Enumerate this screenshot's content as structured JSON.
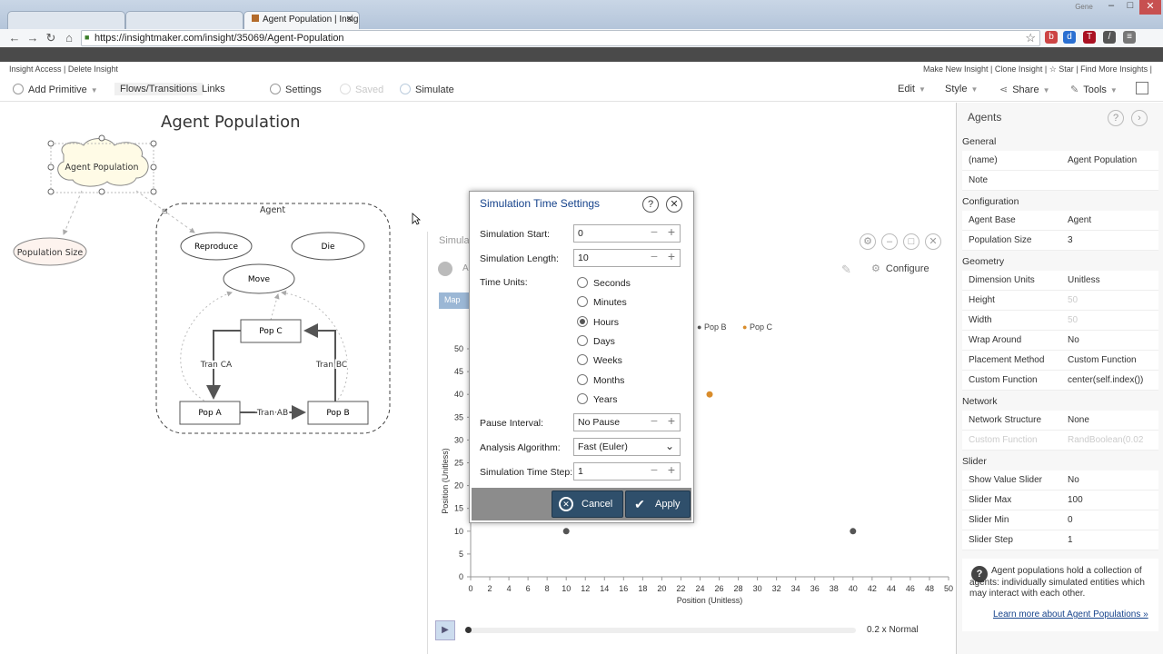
{
  "browser": {
    "tabs": [
      {
        "label": ""
      },
      {
        "label": ""
      },
      {
        "label": "Agent Population | Insight"
      }
    ],
    "window_controls": [
      "Gene",
      "–",
      "□",
      "✕"
    ],
    "url": "https://insightmaker.com/insight/35069/Agent-Population",
    "extensions": [
      "b",
      "d",
      "T",
      "/",
      "≡"
    ],
    "bookmarks": [
      "",
      "",
      "",
      "",
      ""
    ]
  },
  "app": {
    "links_left": "Insight Access | Delete Insight",
    "links_right": "Make New Insight | Clone Insight | ☆ Star | Find More Insights |"
  },
  "toolbar": {
    "add_primitive": "Add Primitive",
    "flows": "Flows/Transitions",
    "links": "Links",
    "settings": "Settings",
    "saved": "Saved",
    "simulate": "Simulate",
    "edit": "Edit",
    "style": "Style",
    "share": "Share",
    "tools": "Tools"
  },
  "diagram": {
    "title": "Agent Population",
    "nodes": {
      "agent_population": "Agent Population",
      "population_size": "Population Size",
      "agent": "Agent",
      "reproduce": "Reproduce",
      "die": "Die",
      "move": "Move",
      "pop_c": "Pop C",
      "pop_a": "Pop A",
      "pop_b": "Pop B",
      "tran_ca": "Tran CA",
      "tran_bc": "Tran BC",
      "tran_ab": "Tran AB"
    }
  },
  "simulation": {
    "title": "Simula",
    "configure": "Configure",
    "map_tab": "Map",
    "legend": [
      "Pop B",
      "Pop C"
    ],
    "play_speed": "0.2 x Normal",
    "chart_data": {
      "type": "scatter",
      "xlabel": "Position (Unitless)",
      "ylabel": "Position (Unitless)",
      "xlim": [
        0,
        50
      ],
      "ylim": [
        0,
        50
      ],
      "x_ticks": [
        0,
        2,
        4,
        6,
        8,
        10,
        12,
        14,
        16,
        18,
        20,
        22,
        24,
        26,
        28,
        30,
        32,
        34,
        36,
        38,
        40,
        42,
        44,
        46,
        48,
        50
      ],
      "y_ticks": [
        0,
        5,
        10,
        15,
        20,
        25,
        30,
        35,
        40,
        45,
        50
      ],
      "series": [
        {
          "name": "Pop A",
          "color": "#555555",
          "points": [
            [
              10,
              10
            ],
            [
              40,
              10
            ]
          ]
        },
        {
          "name": "Pop C",
          "color": "#d98c2b",
          "points": [
            [
              25,
              40
            ]
          ]
        }
      ]
    }
  },
  "dialog": {
    "title": "Simulation Time Settings",
    "sim_start_label": "Simulation Start:",
    "sim_start_value": "0",
    "sim_length_label": "Simulation Length:",
    "sim_length_value": "10",
    "time_units_label": "Time Units:",
    "time_units": [
      {
        "label": "Seconds",
        "selected": false
      },
      {
        "label": "Minutes",
        "selected": false
      },
      {
        "label": "Hours",
        "selected": true
      },
      {
        "label": "Days",
        "selected": false
      },
      {
        "label": "Weeks",
        "selected": false
      },
      {
        "label": "Months",
        "selected": false
      },
      {
        "label": "Years",
        "selected": false
      }
    ],
    "pause_interval_label": "Pause Interval:",
    "pause_interval_value": "No Pause",
    "algorithm_label": "Analysis Algorithm:",
    "algorithm_value": "Fast (Euler)",
    "time_step_label": "Simulation Time Step:",
    "time_step_value": "1",
    "cancel": "Cancel",
    "apply": "Apply"
  },
  "props": {
    "header": "Agents",
    "sections": {
      "general": "General",
      "configuration": "Configuration",
      "geometry": "Geometry",
      "network": "Network",
      "slider": "Slider"
    },
    "rows": {
      "name": {
        "k": "(name)",
        "v": "Agent Population"
      },
      "note": {
        "k": "Note",
        "v": ""
      },
      "agent_base": {
        "k": "Agent Base",
        "v": "Agent"
      },
      "population_size": {
        "k": "Population Size",
        "v": "3"
      },
      "dimension_units": {
        "k": "Dimension Units",
        "v": "Unitless"
      },
      "height": {
        "k": "Height",
        "v": "50"
      },
      "width": {
        "k": "Width",
        "v": "50"
      },
      "wrap_around": {
        "k": "Wrap Around",
        "v": "No"
      },
      "placement_method": {
        "k": "Placement Method",
        "v": "Custom Function"
      },
      "custom_function": {
        "k": "Custom Function",
        "v": "center(self.index())"
      },
      "network_structure": {
        "k": "Network Structure",
        "v": "None"
      },
      "network_function": {
        "k": "Custom Function",
        "v": "RandBoolean(0.02"
      },
      "show_value_slider": {
        "k": "Show Value Slider",
        "v": "No"
      },
      "slider_max": {
        "k": "Slider Max",
        "v": "100"
      },
      "slider_min": {
        "k": "Slider Min",
        "v": "0"
      },
      "slider_step": {
        "k": "Slider Step",
        "v": "1"
      }
    },
    "help_text": "Agent populations hold a collection of agents: individually simulated entities which may interact with each other.",
    "learn_more": "Learn more about Agent Populations »"
  }
}
